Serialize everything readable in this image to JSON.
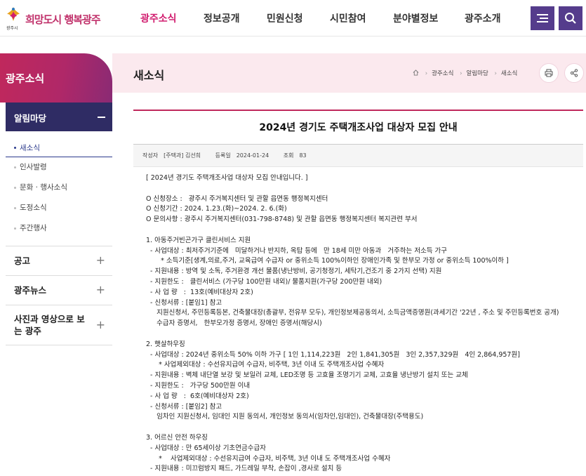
{
  "header": {
    "logo_text": "희망도시 행복광주",
    "logo_sub": "광주시",
    "nav": [
      {
        "label": "광주소식",
        "active": true
      },
      {
        "label": "정보공개",
        "active": false
      },
      {
        "label": "민원신청",
        "active": false
      },
      {
        "label": "시민참여",
        "active": false
      },
      {
        "label": "분야별정보",
        "active": false
      },
      {
        "label": "광주소개",
        "active": false
      }
    ],
    "menu_icon": "hamburger-icon",
    "search_icon": "search-icon",
    "accent": "#d11d6f",
    "button_color": "#553c8c"
  },
  "sidebar": {
    "title": "광주소식",
    "group_title": "알림마당",
    "items": [
      {
        "label": "새소식",
        "active": true
      },
      {
        "label": "인사발령",
        "active": false
      },
      {
        "label": "문화 · 행사소식",
        "active": false
      },
      {
        "label": "도정소식",
        "active": false
      },
      {
        "label": "주간행사",
        "active": false
      }
    ],
    "sections": [
      "공고",
      "광주뉴스",
      "사진과 영상으로 보는 광주"
    ]
  },
  "page": {
    "title": "새소식",
    "breadcrumb": [
      "광주소식",
      "알림마당",
      "새소식"
    ],
    "print_icon": "print-icon",
    "share_icon": "share-icon"
  },
  "article": {
    "title": "2024년 경기도 주택개조사업 대상자 모집 안내",
    "meta": {
      "author_label": "작성자",
      "author": "[주택과] 김선희",
      "date_label": "등록일",
      "date": "2024-01-24",
      "views_label": "조회",
      "views": "83"
    },
    "lines": [
      "[ 2024년 경기도 주택개조사업 대상자 모집 안내입니다. ]",
      "",
      "O 신청장소 :   광주시 주거복지센터 및 관할 읍면동 행정복지센터",
      "O 신청기간 : 2024. 1.23.(화)~2024. 2. 6.(화)",
      "O 문의사항 : 광주시 주거복지센터(031-798-8748) 및 관할 읍면동 행정복지센터 복지관련 부서",
      "",
      "1. 아동주거빈곤가구 클린서비스 지원",
      "  - 사업대상 : 최저주거기준에   미달하거나 반지하, 옥탑 등에   만 18세 미만 아동과   거주하는 저소득 가구",
      "       * 소득기준[생계,의료,주거, 교육급여 수급자 or 중위소득 100%이하인 장애인가족 및 한부모 가정 or 중위소득 100%이하 ]",
      "  - 지원내용 : 방역 및 소독, 주거환경 개선 물품(냉난방비, 공기청정기, 세탁기,건조기 중 2가지 선택) 지원",
      "  - 지원한도 :   클린서비스 (가구당 100만원 내외)/ 물품지원(가구당 200만원 내외)",
      "  - 사 업 량   :  13호(예비대상자 2호)",
      "  - 신청서류 : [붙임1] 참고",
      "     지원신청서, 주민등록등본, 건축물대장(총괄부, 전유부 모두), 개인정보제공동의서, 소득금액증명원(과세기간 '22년 , 주소 및 주민등록번호 공개)",
      "     수급자 증명서,   한부모가정 증명서, 장애인 증명서(해당시)",
      "",
      "2. 햇살하우징",
      "  - 사업대상 : 2024년 중위소득 50% 이하 가구 [ 1인 1,114,223원   2인 1,841,305원   3인 2,357,329원   4인 2,864,957원]",
      "      * 사업제외대상 : 수선유지급여 수급자, 비주택, 3년 이내 도 주택개조사업 수혜자",
      "  - 지원내용 : 벽체 내단열 보강 및 보일러 교체, LED조명 등 고효율 조명기기 교체, 고효율 냉난방기 설치 또는 교체",
      "  - 지원한도 :   가구당 500만원 이내",
      "  - 사 업 량   :  6호(예비대상자 2호)",
      "  - 신청서류 : [붙임2] 참고",
      "     임차인 지원신청서, 임대인 지원 동의서, 개인정보 동의서(임차인,임대인), 건축물대장(주택용도)",
      "",
      "3. 어르신 안전 하우징",
      "  - 사업대상 : 만 65세이상 기초연금수급자",
      "      *    사업제외대상 : 수선유지급여 수급자, 비주택, 3년 이내 도 주택개조사업 수혜자",
      "  - 지원내용 : 미끄럼방지 패드, 가드레일 부착, 손잡이 ,경사로 설치 등"
    ]
  }
}
